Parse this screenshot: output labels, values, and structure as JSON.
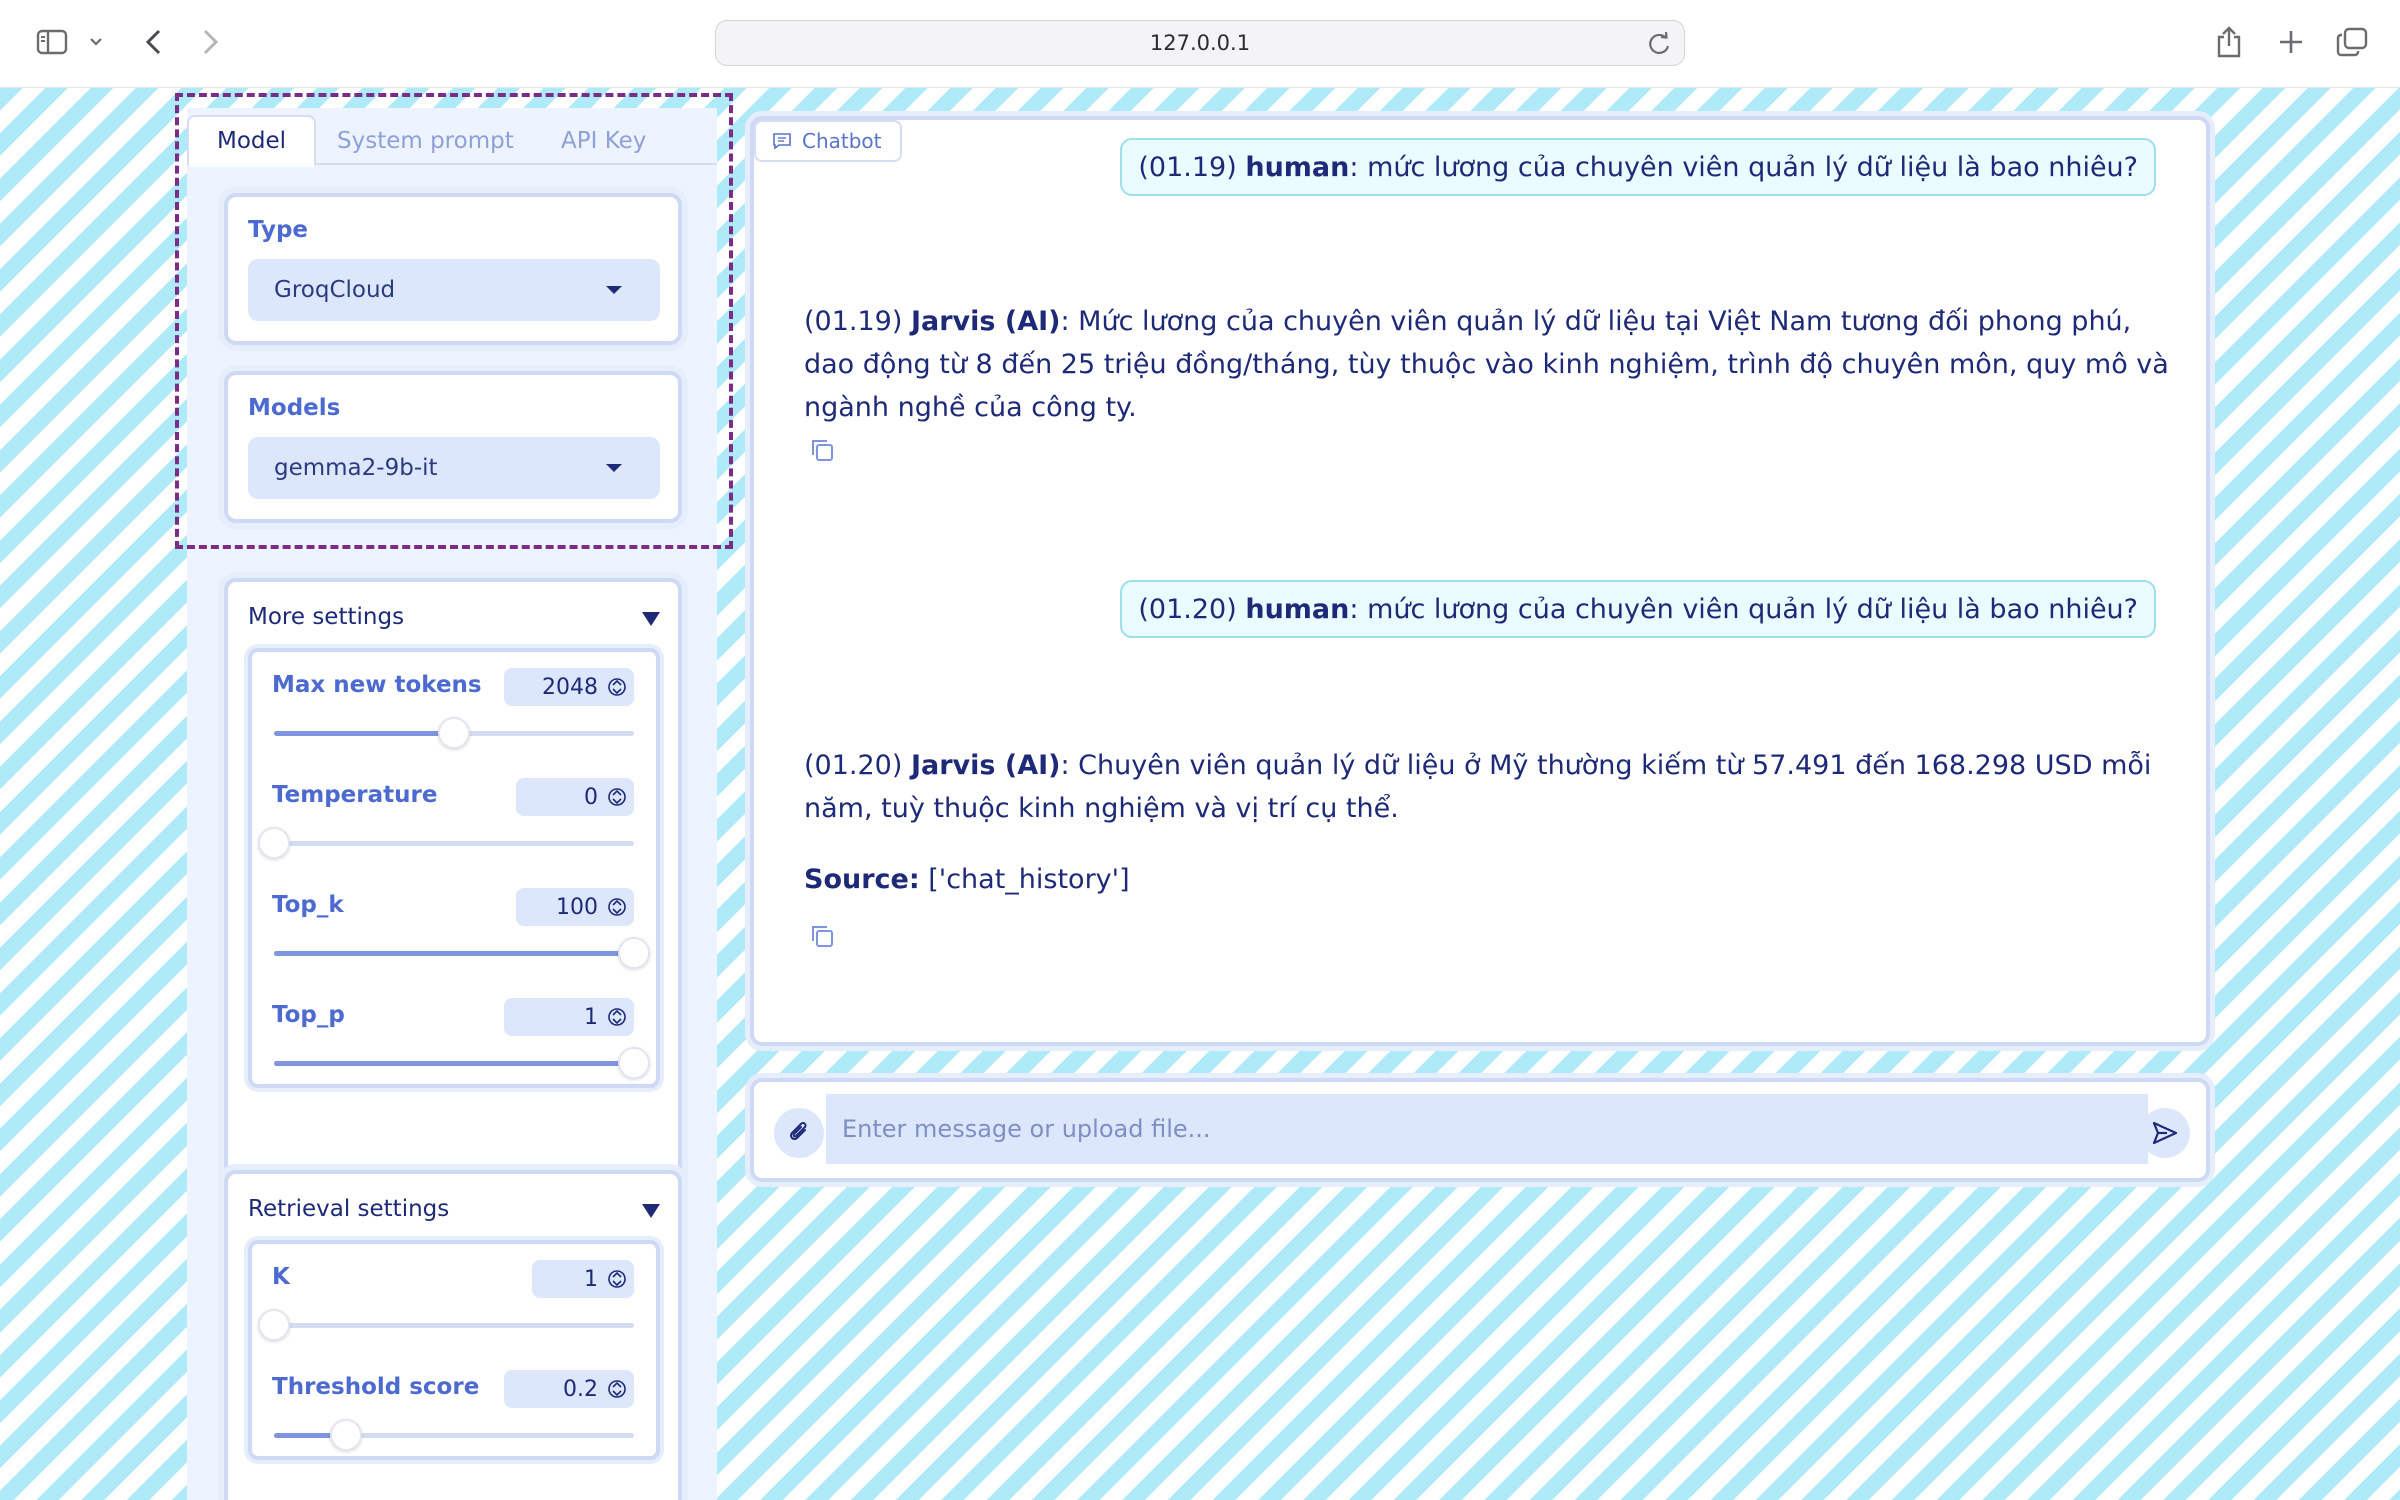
{
  "browser": {
    "url": "127.0.0.1"
  },
  "left": {
    "tabs": [
      {
        "label": "Model",
        "active": true
      },
      {
        "label": "System prompt",
        "active": false
      },
      {
        "label": "API Key",
        "active": false
      }
    ],
    "type": {
      "label": "Type",
      "value": "GroqCloud"
    },
    "models": {
      "label": "Models",
      "value": "gemma2-9b-it"
    },
    "more_settings": {
      "title": "More settings",
      "sliders": [
        {
          "label": "Max new tokens",
          "value": "2048",
          "fraction": 0.5
        },
        {
          "label": "Temperature",
          "value": "0",
          "fraction": 0.0
        },
        {
          "label": "Top_k",
          "value": "100",
          "fraction": 1.0
        },
        {
          "label": "Top_p",
          "value": "1",
          "fraction": 1.0
        }
      ]
    },
    "retrieval_settings": {
      "title": "Retrieval settings",
      "sliders": [
        {
          "label": "K",
          "value": "1",
          "fraction": 0.0
        },
        {
          "label": "Threshold score",
          "value": "0.2",
          "fraction": 0.2
        }
      ]
    }
  },
  "chat": {
    "label": "Chatbot",
    "messages": [
      {
        "role": "user",
        "time": "(01.19)",
        "speaker": "human",
        "text": ": mức lương của chuyên viên quản lý dữ liệu là bao nhiêu?"
      },
      {
        "role": "bot",
        "time": "(01.19)",
        "speaker": "Jarvis (AI)",
        "text": ": Mức lương của chuyên viên quản lý dữ liệu tại Việt Nam tương đối phong phú, dao động từ 8 đến 25 triệu đồng/tháng, tùy thuộc vào kinh nghiệm, trình độ chuyên môn, quy mô và ngành nghề của công ty."
      },
      {
        "role": "user",
        "time": "(01.20)",
        "speaker": "human",
        "text": ": mức lương của chuyên viên quản lý dữ liệu là bao nhiêu?"
      },
      {
        "role": "bot",
        "time": "(01.20)",
        "speaker": "Jarvis (AI)",
        "text": ": Chuyên viên quản lý dữ liệu ở Mỹ thường kiếm từ 57.491 đến 168.298 USD mỗi năm, tuỳ thuộc kinh nghiệm và vị trí cụ thể.",
        "source_label": "Source:",
        "source_value": " ['chat_history']"
      }
    ]
  },
  "composer": {
    "placeholder": "Enter message or upload file..."
  }
}
